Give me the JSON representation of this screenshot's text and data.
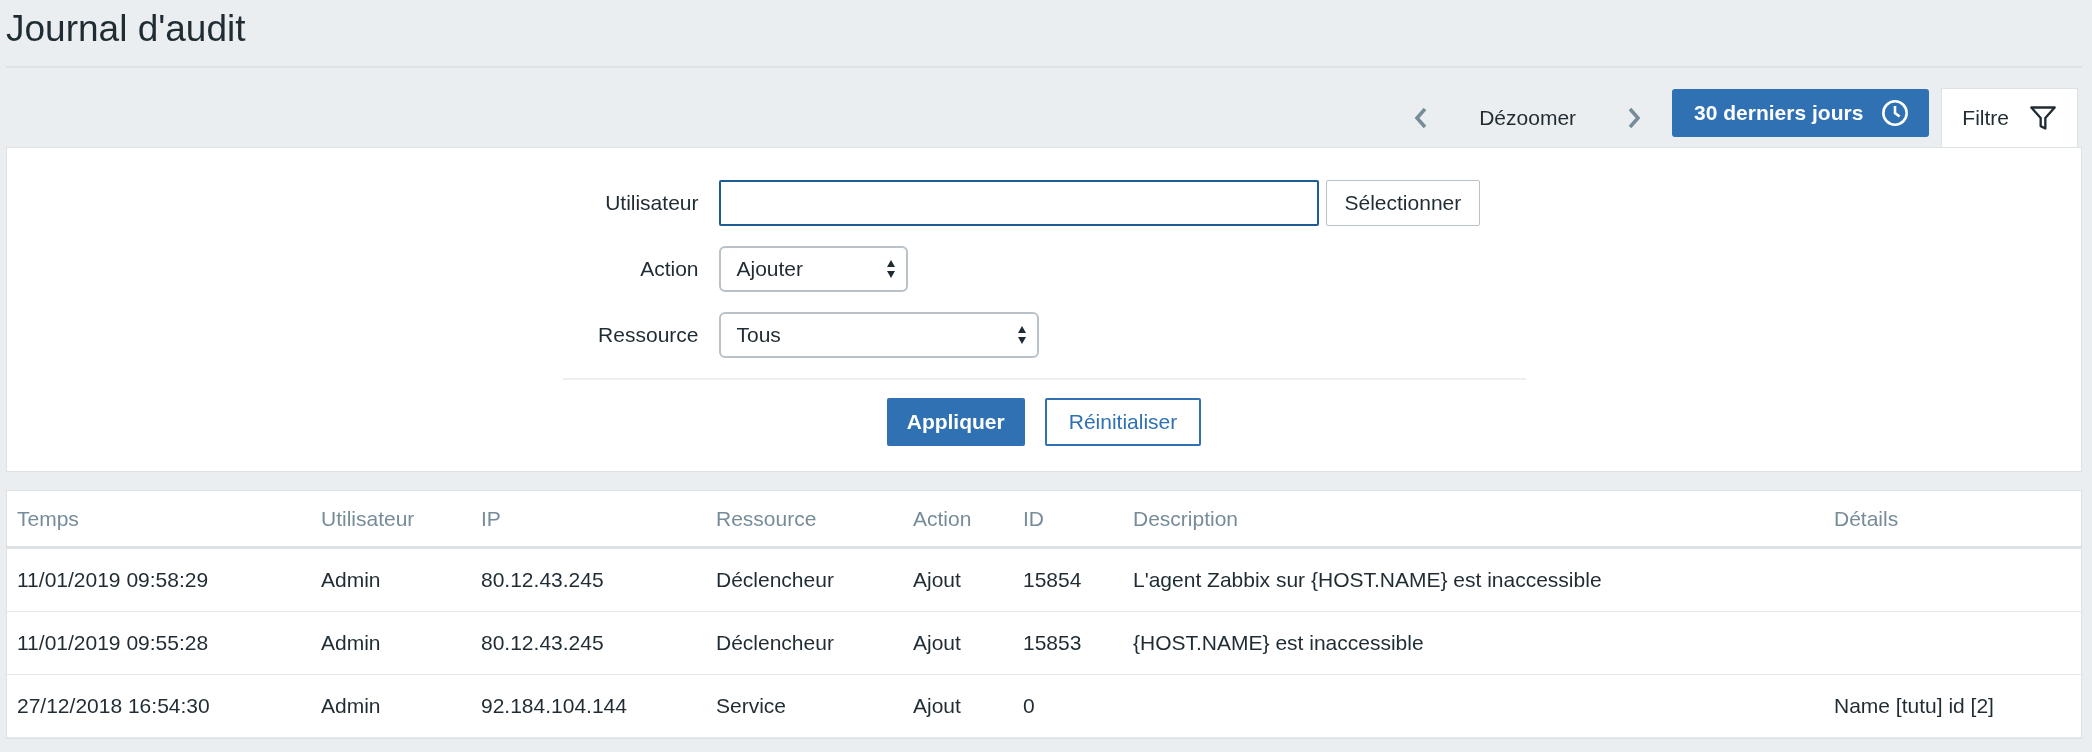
{
  "page_title": "Journal d'audit",
  "toolbar": {
    "zoom_out": "Dézoomer",
    "time_range": "30 derniers jours",
    "filter_tab": {
      "label": "Filtre",
      "selected": true
    }
  },
  "filter": {
    "fields": [
      {
        "kind": "text",
        "label": "Utilisateur",
        "button": "Sélectionner"
      },
      {
        "kind": "select",
        "label": "Action",
        "value": "Ajouter"
      },
      {
        "kind": "select",
        "label": "Ressource",
        "value": "Tous"
      }
    ],
    "apply": "Appliquer",
    "reset": "Réinitialiser"
  },
  "table": {
    "columns": [
      "Temps",
      "Utilisateur",
      "IP",
      "Ressource",
      "Action",
      "ID",
      "Description",
      "Détails"
    ],
    "rows": [
      [
        "11/01/2019 09:58:29",
        "Admin",
        "80.12.43.245",
        "Déclencheur",
        "Ajout",
        "15854",
        "L'agent Zabbix sur {HOST.NAME} est inaccessible",
        null
      ],
      [
        "11/01/2019 09:55:28",
        "Admin",
        "80.12.43.245",
        "Déclencheur",
        "Ajout",
        "15853",
        "{HOST.NAME} est inaccessible",
        null
      ],
      [
        "27/12/2018 16:54:30",
        "Admin",
        "92.184.104.144",
        "Service",
        "Ajout",
        "0",
        null,
        "Name [tutu] id [2]"
      ]
    ]
  }
}
